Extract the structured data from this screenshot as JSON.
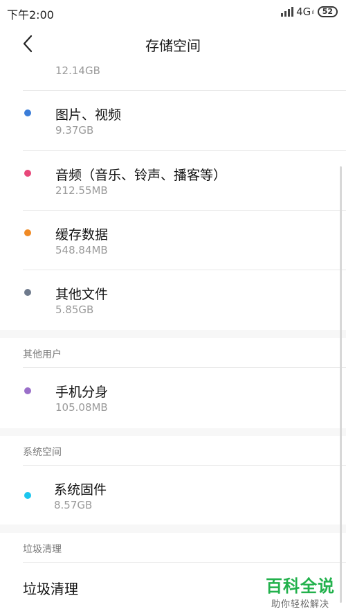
{
  "status_bar": {
    "time": "下午2:00",
    "network": "4G",
    "network_sub": "ıl",
    "battery": "52"
  },
  "header": {
    "title": "存储空间"
  },
  "storage_items": [
    {
      "label": "",
      "size": "12.14GB",
      "color": "#3b7dd8"
    },
    {
      "label": "图片、视频",
      "size": "9.37GB",
      "color": "#3b7dd8"
    },
    {
      "label": "音频（音乐、铃声、播客等）",
      "size": "212.55MB",
      "color": "#e8477a"
    },
    {
      "label": "缓存数据",
      "size": "548.84MB",
      "color": "#f08a24"
    },
    {
      "label": "其他文件",
      "size": "5.85GB",
      "color": "#6e7a8c"
    }
  ],
  "other_users": {
    "header": "其他用户",
    "items": [
      {
        "label": "手机分身",
        "size": "105.08MB",
        "color": "#9a6fc9"
      }
    ]
  },
  "system_space": {
    "header": "系统空间",
    "items": [
      {
        "label": "系统固件",
        "size": "8.57GB",
        "color": "#1cc6ee"
      }
    ]
  },
  "junk_cleanup": {
    "header": "垃圾清理",
    "item_label": "垃圾清理"
  },
  "watermark": {
    "main": "百科全说",
    "sub": "助你轻松解决"
  }
}
